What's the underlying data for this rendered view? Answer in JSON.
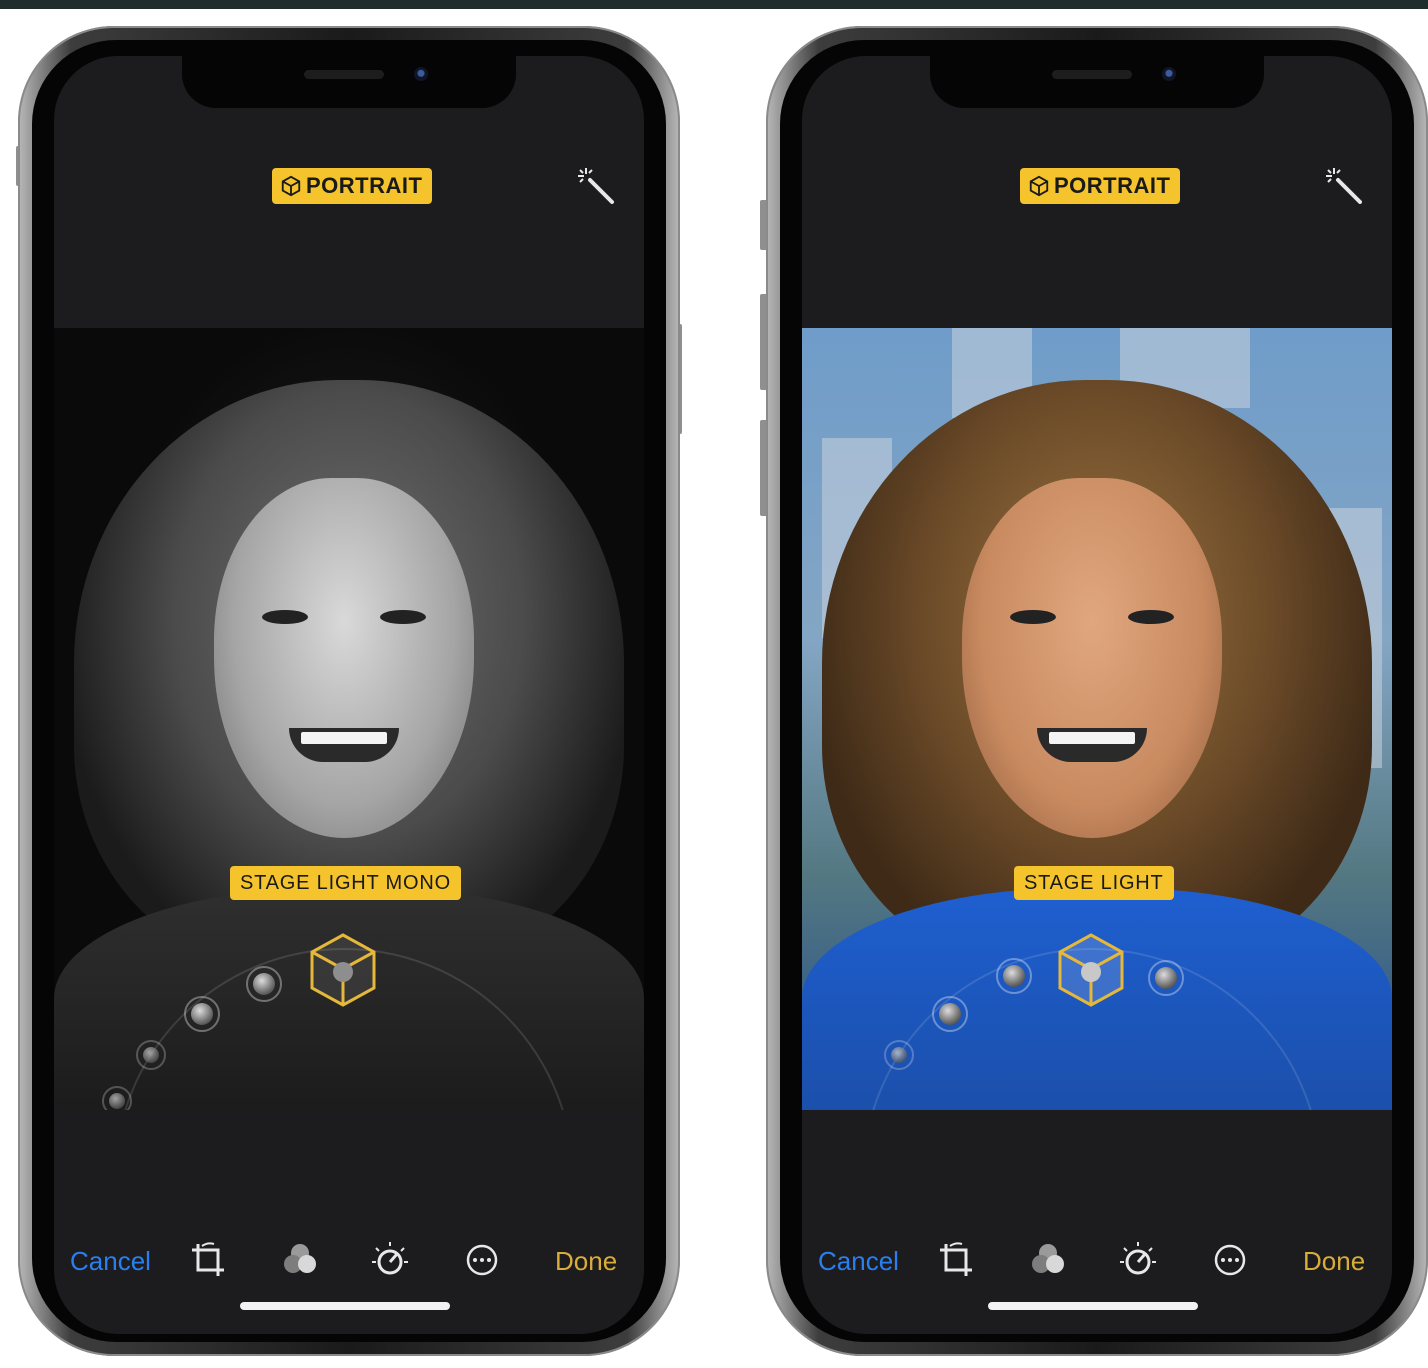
{
  "phones": [
    {
      "id": "left",
      "portrait_label": "PORTRAIT",
      "lighting_label": "STAGE LIGHT MONO",
      "photo_style": "mono",
      "toolbar": {
        "cancel": "Cancel",
        "done": "Done"
      }
    },
    {
      "id": "right",
      "portrait_label": "PORTRAIT",
      "lighting_label": "STAGE LIGHT",
      "photo_style": "color",
      "toolbar": {
        "cancel": "Cancel",
        "done": "Done"
      }
    }
  ],
  "colors": {
    "badge_yellow": "#f5c32c",
    "cancel_blue": "#2a7ff0",
    "done_gold": "#d9ad3a",
    "screen_bg": "#1c1c1e"
  },
  "icons": {
    "portrait_badge": "cube-icon",
    "top_right": "magic-wand-icon",
    "lighting_selected": "stage-light-cube-icon",
    "toolbar": [
      "crop-rotate-icon",
      "filters-icon",
      "adjust-dial-icon",
      "more-options-icon"
    ]
  }
}
